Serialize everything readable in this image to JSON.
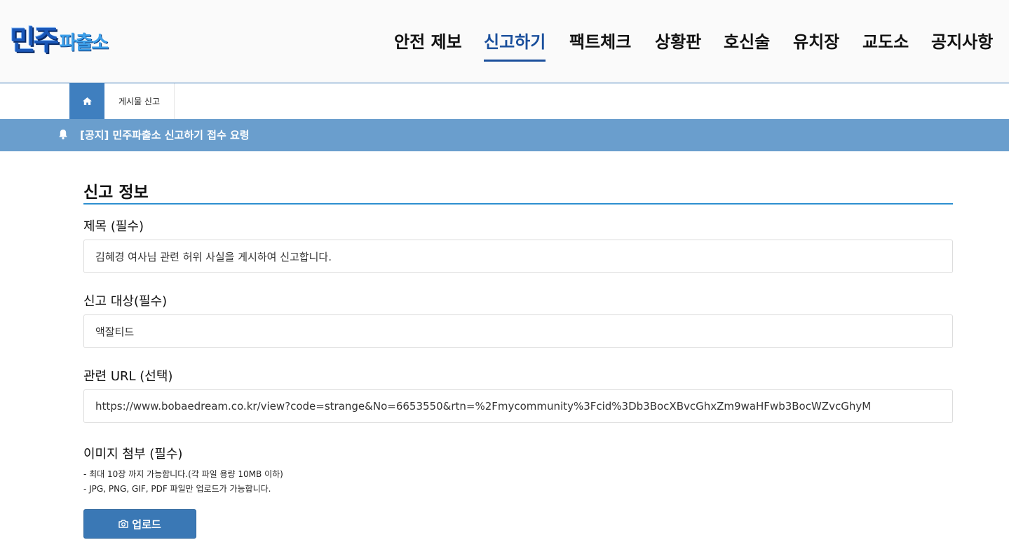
{
  "header": {
    "logo_main": "민주",
    "logo_sub": "파출소",
    "nav": [
      {
        "label": "안전 제보"
      },
      {
        "label": "신고하기"
      },
      {
        "label": "팩트체크"
      },
      {
        "label": "상황판"
      },
      {
        "label": "호신술"
      },
      {
        "label": "유치장"
      },
      {
        "label": "교도소"
      },
      {
        "label": "공지사항"
      }
    ],
    "active_nav": "신고하기"
  },
  "breadcrumb": {
    "home_icon": "home-icon",
    "current": "게시물 신고"
  },
  "notice": {
    "icon": "bell-icon",
    "text": "[공지] 민주파출소 신고하기 접수 요령"
  },
  "form": {
    "section_title": "신고 정보",
    "title_label": "제목 (필수)",
    "title_value": "김혜경 여사님 관련 허위 사실을 게시하여 신고합니다.",
    "target_label": "신고 대상(필수)",
    "target_value": "액잘티드",
    "url_label": "관련 URL (선택)",
    "url_value": "https://www.bobaedream.co.kr/view?code=strange&No=6653550&rtn=%2Fmycommunity%3Fcid%3Db3BocXBvcGhxZm9waHFwb3BocWZvcGhyM",
    "image_label": "이미지 첨부 (필수)",
    "image_help_1": "- 최대 10장 까지 가능합니다.(각 파일 용량 10MB 이하)",
    "image_help_2": "- JPG, PNG, GIF, PDF 파일만 업로드가 가능합니다.",
    "upload_label": "업로드",
    "upload_icon": "camera-icon"
  },
  "colors": {
    "primary": "#3a78b5",
    "nav_active": "#1a4f9c",
    "notice_bar": "#6a9ecd",
    "section_rule": "#2d8fd0"
  }
}
